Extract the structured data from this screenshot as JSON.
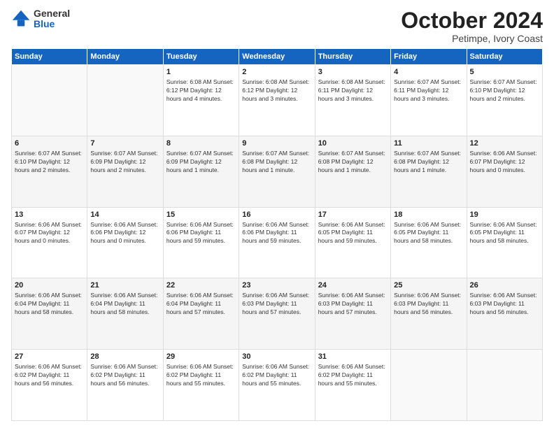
{
  "logo": {
    "general": "General",
    "blue": "Blue"
  },
  "title": "October 2024",
  "subtitle": "Petimpe, Ivory Coast",
  "weekdays": [
    "Sunday",
    "Monday",
    "Tuesday",
    "Wednesday",
    "Thursday",
    "Friday",
    "Saturday"
  ],
  "weeks": [
    [
      {
        "day": "",
        "info": ""
      },
      {
        "day": "",
        "info": ""
      },
      {
        "day": "1",
        "info": "Sunrise: 6:08 AM\nSunset: 6:12 PM\nDaylight: 12 hours\nand 4 minutes."
      },
      {
        "day": "2",
        "info": "Sunrise: 6:08 AM\nSunset: 6:12 PM\nDaylight: 12 hours\nand 3 minutes."
      },
      {
        "day": "3",
        "info": "Sunrise: 6:08 AM\nSunset: 6:11 PM\nDaylight: 12 hours\nand 3 minutes."
      },
      {
        "day": "4",
        "info": "Sunrise: 6:07 AM\nSunset: 6:11 PM\nDaylight: 12 hours\nand 3 minutes."
      },
      {
        "day": "5",
        "info": "Sunrise: 6:07 AM\nSunset: 6:10 PM\nDaylight: 12 hours\nand 2 minutes."
      }
    ],
    [
      {
        "day": "6",
        "info": "Sunrise: 6:07 AM\nSunset: 6:10 PM\nDaylight: 12 hours\nand 2 minutes."
      },
      {
        "day": "7",
        "info": "Sunrise: 6:07 AM\nSunset: 6:09 PM\nDaylight: 12 hours\nand 2 minutes."
      },
      {
        "day": "8",
        "info": "Sunrise: 6:07 AM\nSunset: 6:09 PM\nDaylight: 12 hours\nand 1 minute."
      },
      {
        "day": "9",
        "info": "Sunrise: 6:07 AM\nSunset: 6:08 PM\nDaylight: 12 hours\nand 1 minute."
      },
      {
        "day": "10",
        "info": "Sunrise: 6:07 AM\nSunset: 6:08 PM\nDaylight: 12 hours\nand 1 minute."
      },
      {
        "day": "11",
        "info": "Sunrise: 6:07 AM\nSunset: 6:08 PM\nDaylight: 12 hours\nand 1 minute."
      },
      {
        "day": "12",
        "info": "Sunrise: 6:06 AM\nSunset: 6:07 PM\nDaylight: 12 hours\nand 0 minutes."
      }
    ],
    [
      {
        "day": "13",
        "info": "Sunrise: 6:06 AM\nSunset: 6:07 PM\nDaylight: 12 hours\nand 0 minutes."
      },
      {
        "day": "14",
        "info": "Sunrise: 6:06 AM\nSunset: 6:06 PM\nDaylight: 12 hours\nand 0 minutes."
      },
      {
        "day": "15",
        "info": "Sunrise: 6:06 AM\nSunset: 6:06 PM\nDaylight: 11 hours\nand 59 minutes."
      },
      {
        "day": "16",
        "info": "Sunrise: 6:06 AM\nSunset: 6:06 PM\nDaylight: 11 hours\nand 59 minutes."
      },
      {
        "day": "17",
        "info": "Sunrise: 6:06 AM\nSunset: 6:05 PM\nDaylight: 11 hours\nand 59 minutes."
      },
      {
        "day": "18",
        "info": "Sunrise: 6:06 AM\nSunset: 6:05 PM\nDaylight: 11 hours\nand 58 minutes."
      },
      {
        "day": "19",
        "info": "Sunrise: 6:06 AM\nSunset: 6:05 PM\nDaylight: 11 hours\nand 58 minutes."
      }
    ],
    [
      {
        "day": "20",
        "info": "Sunrise: 6:06 AM\nSunset: 6:04 PM\nDaylight: 11 hours\nand 58 minutes."
      },
      {
        "day": "21",
        "info": "Sunrise: 6:06 AM\nSunset: 6:04 PM\nDaylight: 11 hours\nand 58 minutes."
      },
      {
        "day": "22",
        "info": "Sunrise: 6:06 AM\nSunset: 6:04 PM\nDaylight: 11 hours\nand 57 minutes."
      },
      {
        "day": "23",
        "info": "Sunrise: 6:06 AM\nSunset: 6:03 PM\nDaylight: 11 hours\nand 57 minutes."
      },
      {
        "day": "24",
        "info": "Sunrise: 6:06 AM\nSunset: 6:03 PM\nDaylight: 11 hours\nand 57 minutes."
      },
      {
        "day": "25",
        "info": "Sunrise: 6:06 AM\nSunset: 6:03 PM\nDaylight: 11 hours\nand 56 minutes."
      },
      {
        "day": "26",
        "info": "Sunrise: 6:06 AM\nSunset: 6:03 PM\nDaylight: 11 hours\nand 56 minutes."
      }
    ],
    [
      {
        "day": "27",
        "info": "Sunrise: 6:06 AM\nSunset: 6:02 PM\nDaylight: 11 hours\nand 56 minutes."
      },
      {
        "day": "28",
        "info": "Sunrise: 6:06 AM\nSunset: 6:02 PM\nDaylight: 11 hours\nand 56 minutes."
      },
      {
        "day": "29",
        "info": "Sunrise: 6:06 AM\nSunset: 6:02 PM\nDaylight: 11 hours\nand 55 minutes."
      },
      {
        "day": "30",
        "info": "Sunrise: 6:06 AM\nSunset: 6:02 PM\nDaylight: 11 hours\nand 55 minutes."
      },
      {
        "day": "31",
        "info": "Sunrise: 6:06 AM\nSunset: 6:02 PM\nDaylight: 11 hours\nand 55 minutes."
      },
      {
        "day": "",
        "info": ""
      },
      {
        "day": "",
        "info": ""
      }
    ]
  ]
}
